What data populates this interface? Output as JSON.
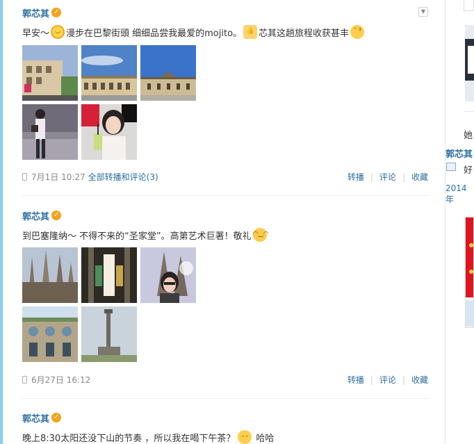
{
  "posts": [
    {
      "author": "郭芯其",
      "text_parts": [
        "早安～",
        "漫步在巴黎街頭 细细品尝我最爱的mojito。",
        "芯其这趟旅程收获甚丰"
      ],
      "time": "7月1日 10:27",
      "forward_comment_label": "全部转播和评论(3)",
      "actions": [
        "转播",
        "评论",
        "收藏"
      ]
    },
    {
      "author": "郭芯其",
      "text": "到巴塞隆纳～ 不得不来的“圣家堂”。高第艺术巨著！敬礼",
      "time": "6月27日 16:12",
      "actions": [
        "转播",
        "评论",
        "收藏"
      ]
    },
    {
      "author": "郭芯其",
      "text": "晚上8:30太阳还没下山的节奏 ，所以我在喝下午茶？",
      "text_tail": "哈哈"
    }
  ],
  "sidebar": {
    "text_1": "她",
    "name": "郭芯其",
    "text_2": "好",
    "date": "2014年"
  },
  "colors": {
    "link": "#2b6ea1",
    "meta": "#888888",
    "badge": "#f3a21c",
    "left_edge": "#8ccdf0"
  },
  "icons": [
    "v-badge-icon",
    "collapse-arrow-icon",
    "mobile-phone-icon",
    "sun-emoji-icon",
    "thumbs-up-emoji-icon",
    "kiss-emoji-icon",
    "salute-emoji-icon",
    "sleepy-emoji-icon",
    "image-icon"
  ]
}
